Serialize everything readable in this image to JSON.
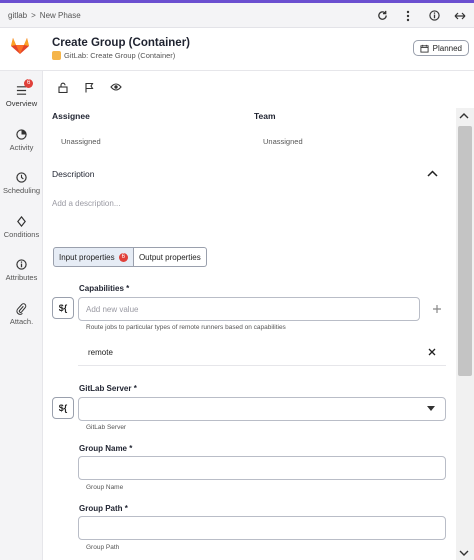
{
  "breadcrumb": {
    "root": "gitlab",
    "separator": ">",
    "current": "New Phase"
  },
  "header": {
    "title": "Create Group (Container)",
    "subtitle": "GitLab: Create Group (Container)",
    "status": "Planned"
  },
  "sidebar": {
    "items": [
      {
        "label": "Overview",
        "icon": "list-icon",
        "badge": "6"
      },
      {
        "label": "Activity",
        "icon": "activity-icon"
      },
      {
        "label": "Scheduling",
        "icon": "clock-icon"
      },
      {
        "label": "Conditions",
        "icon": "diamond-icon"
      },
      {
        "label": "Attributes",
        "icon": "info-icon"
      },
      {
        "label": "Attach.",
        "icon": "paperclip-icon"
      }
    ]
  },
  "people": {
    "assignee_label": "Assignee",
    "assignee_value": "Unassigned",
    "team_label": "Team",
    "team_value": "Unassigned"
  },
  "description": {
    "label": "Description",
    "placeholder": "Add a description..."
  },
  "tabs": {
    "input": "Input properties",
    "input_badge": "6",
    "output": "Output properties"
  },
  "fields": {
    "capabilities": {
      "label": "Capabilities *",
      "placeholder": "Add new value",
      "helper": "Route jobs to particular types of remote runners based on capabilities",
      "values": [
        "remote"
      ]
    },
    "gitlab_server": {
      "label": "GitLab Server *",
      "helper": "GitLab Server"
    },
    "group_name": {
      "label": "Group Name *",
      "helper": "Group Name"
    },
    "group_path": {
      "label": "Group Path *",
      "helper": "Group Path"
    }
  },
  "dollar_label": "${"
}
